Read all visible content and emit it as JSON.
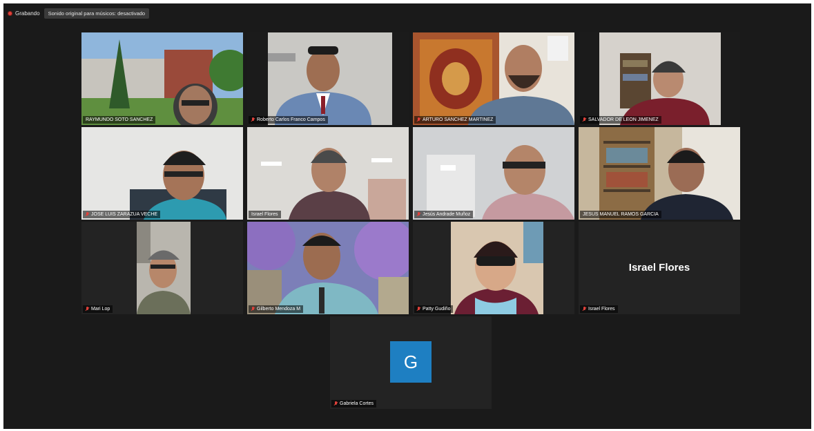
{
  "topbar": {
    "recording_label": "Grabando",
    "original_sound_button": "Sonido original para músicos: desactivado"
  },
  "participants": [
    {
      "name": "RAYMUNDO SOTO SANCHEZ",
      "muted": false
    },
    {
      "name": "Roberto Carlos Franco Campos",
      "muted": true
    },
    {
      "name": "ARTURO SANCHEZ MARTINEZ",
      "muted": true
    },
    {
      "name": "SALVADOR DE LEON JIMENEZ",
      "muted": true
    },
    {
      "name": "JOSE LUIS ZARAZUA VECHE",
      "muted": true
    },
    {
      "name": "Israel Flores",
      "muted": false,
      "active_speaker": true
    },
    {
      "name": "Jesús Andrade Muñoz",
      "muted": true
    },
    {
      "name": "JESUS MANUEL RAMOS GARCIA",
      "muted": false
    },
    {
      "name": "Mari Lop",
      "muted": true
    },
    {
      "name": "Gilberto Mendoza M",
      "muted": true
    },
    {
      "name": "Patty Gudiño",
      "muted": true
    },
    {
      "name": "Israel Flores",
      "muted": true,
      "video_off": true,
      "display_text": "Israel Flores"
    },
    {
      "name": "Gabriela Cortes",
      "muted": true,
      "video_off": true,
      "avatar_letter": "G"
    }
  ],
  "colors": {
    "window_bg": "#1a1a1a",
    "active_speaker_border": "#7fc84a",
    "muted_icon": "#e0413a",
    "avatar_bg": "#1e7fc2"
  }
}
